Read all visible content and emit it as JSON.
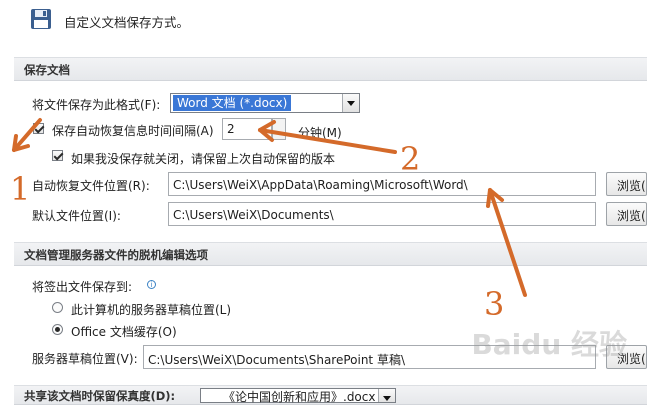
{
  "header": {
    "title": "自定义文档保存方式。"
  },
  "sections": {
    "save_documents": "保存文档",
    "offline_editing": "文档管理服务器文件的脱机编辑选项",
    "preserve_fidelity": "共享该文档时保留保真度(D):"
  },
  "save_format": {
    "label": "将文件保存为此格式(F):",
    "value": "Word 文档 (*.docx)"
  },
  "autorecover": {
    "label": "保存自动恢复信息时间间隔(A)",
    "value": "2",
    "unit": "分钟(M)",
    "checked": true
  },
  "keep_last": {
    "label": "如果我没保存就关闭，请保留上次自动保留的版本",
    "checked": true
  },
  "autorecover_location": {
    "label": "自动恢复文件位置(R):",
    "value": "C:\\Users\\WeiX\\AppData\\Roaming\\Microsoft\\Word\\",
    "button": "浏览("
  },
  "default_location": {
    "label": "默认文件位置(I):",
    "value": "C:\\Users\\WeiX\\Documents\\",
    "button": "浏览("
  },
  "checkout": {
    "label": "将签出文件保存到:",
    "option_server": "此计算机的服务器草稿位置(L)",
    "option_cache": "Office 文档缓存(O)",
    "selected": "option_cache"
  },
  "server_drafts": {
    "label": "服务器草稿位置(V):",
    "value": "C:\\Users\\WeiX\\Documents\\SharePoint 草稿\\",
    "button": "浏览("
  },
  "fidelity_doc": {
    "value": "《论中国创新和应用》.docx"
  },
  "annotations": {
    "n1": "1",
    "n2": "2",
    "n3": "3"
  },
  "watermark": "Baidu 经验",
  "colors": {
    "accent": "#3a77d6",
    "annotation": "#d46a2a"
  }
}
